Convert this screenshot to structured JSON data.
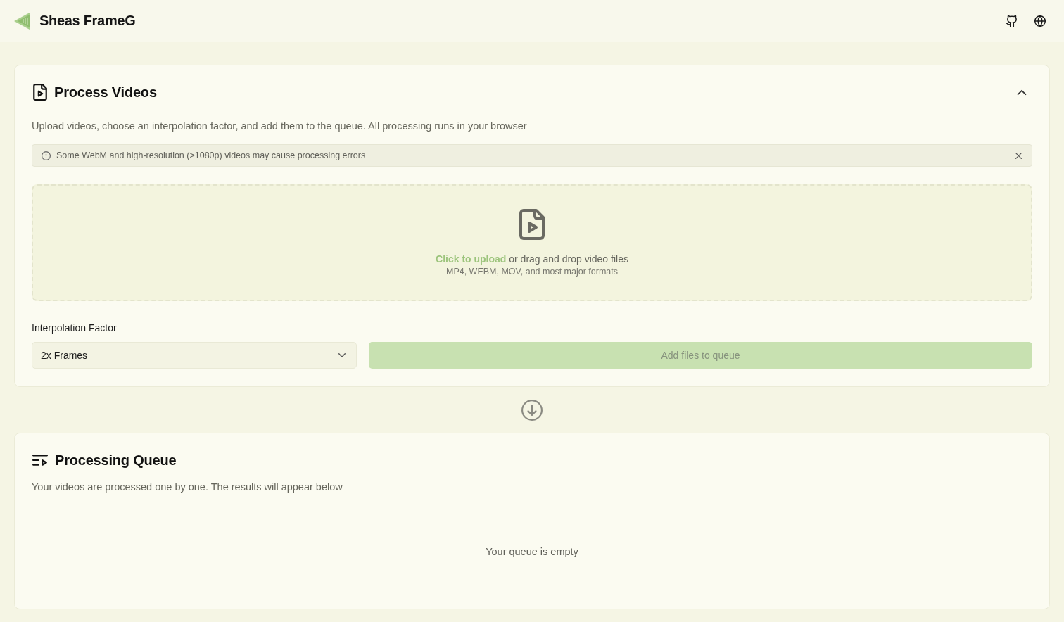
{
  "header": {
    "brand": "Sheas FrameG"
  },
  "process_panel": {
    "title": "Process Videos",
    "expanded": true,
    "description": "Upload videos, choose an interpolation factor, and add them to the queue. All processing runs in your browser",
    "alert": {
      "message": "Some WebM and high-resolution (>1080p) videos may cause processing errors"
    },
    "dropzone": {
      "link": "Click to upload",
      "text": "or drag and drop video files",
      "formats": "MP4, WEBM, MOV, and most major formats"
    },
    "interpolation": {
      "label": "Interpolation Factor",
      "value": "2x Frames"
    },
    "add_button": {
      "label": "Add files to queue",
      "disabled": true
    }
  },
  "queue_panel": {
    "title": "Processing Queue",
    "description": "Your videos are processed one by one. The results will appear below",
    "empty_message": "Your queue is empty"
  }
}
